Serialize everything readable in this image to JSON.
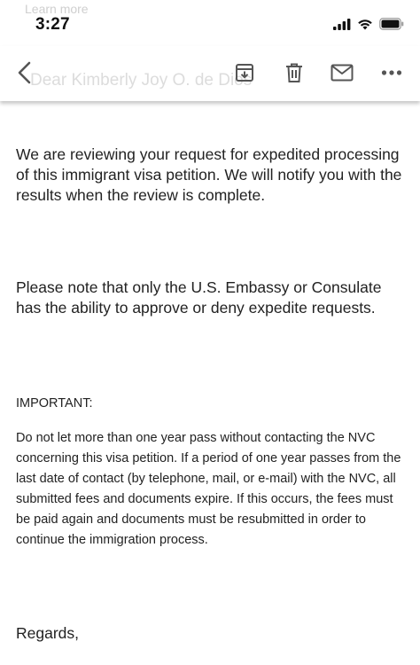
{
  "status_bar": {
    "time": "3:27",
    "ghost_text": "Learn more"
  },
  "toolbar": {
    "ghost_sender": "Dear Kimberly Joy O. de Dios",
    "icons": [
      "back-arrow-icon",
      "archive-icon",
      "trash-icon",
      "mail-icon",
      "more-icon"
    ]
  },
  "email": {
    "paragraph_1": "We are reviewing your request for expedited processing of this immigrant visa petition. We will notify you with the results when the review is complete.",
    "paragraph_2": "Please note that only the U.S. Embassy or Consulate has the ability to approve or deny expedite requests.",
    "important_label": "IMPORTANT:",
    "important_text": "Do not let more than one year pass without contacting the NVC concerning this visa petition. If a period of one year passes from the last date of contact (by telephone, mail, or e-mail) with the NVC, all submitted fees and documents expire. If this occurs, the fees must be paid again and documents must be resubmitted in order to continue the immigration process.",
    "closing": "Regards,"
  },
  "colors": {
    "text": "#222222",
    "icon": "#555555",
    "ghost": "#d9d9d9"
  }
}
